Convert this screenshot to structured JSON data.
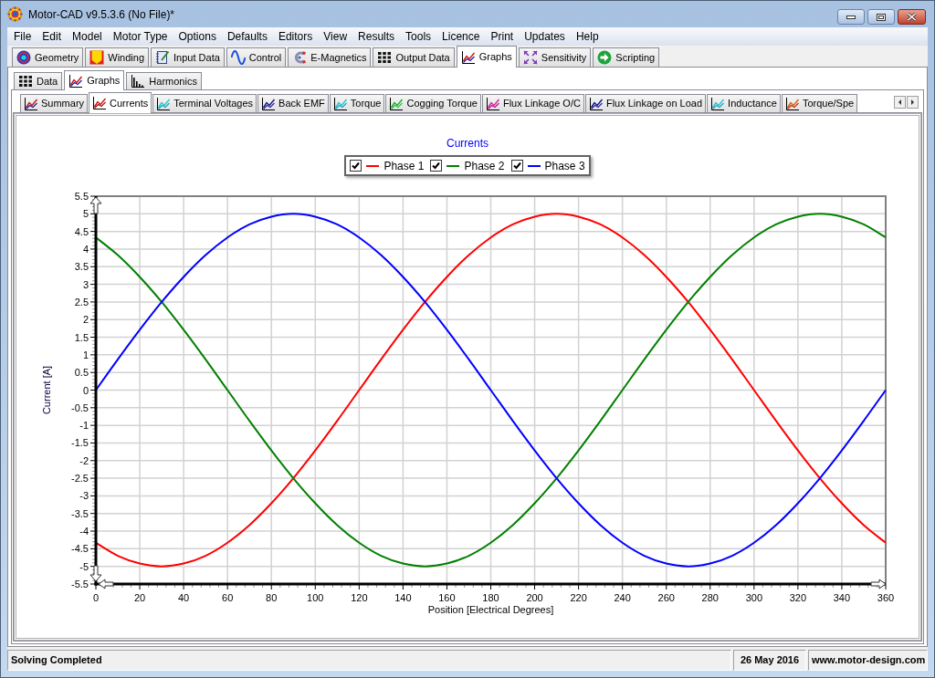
{
  "window": {
    "title": "Motor-CAD v9.5.3.6 (No File)*"
  },
  "menu": [
    "File",
    "Edit",
    "Model",
    "Motor Type",
    "Options",
    "Defaults",
    "Editors",
    "View",
    "Results",
    "Tools",
    "Licence",
    "Print",
    "Updates",
    "Help"
  ],
  "main_tabs": [
    {
      "label": "Geometry",
      "selected": false
    },
    {
      "label": "Winding",
      "selected": false
    },
    {
      "label": "Input Data",
      "selected": false
    },
    {
      "label": "Control",
      "selected": false
    },
    {
      "label": "E-Magnetics",
      "selected": false
    },
    {
      "label": "Output Data",
      "selected": false
    },
    {
      "label": "Graphs",
      "selected": true
    },
    {
      "label": "Sensitivity",
      "selected": false
    },
    {
      "label": "Scripting",
      "selected": false
    }
  ],
  "sub_tabs": [
    {
      "label": "Data",
      "selected": false
    },
    {
      "label": "Graphs",
      "selected": true
    },
    {
      "label": "Harmonics",
      "selected": false
    }
  ],
  "graph_tabs": [
    {
      "label": "Summary",
      "selected": false
    },
    {
      "label": "Currents",
      "selected": true
    },
    {
      "label": "Terminal Voltages",
      "selected": false
    },
    {
      "label": "Back EMF",
      "selected": false
    },
    {
      "label": "Torque",
      "selected": false
    },
    {
      "label": "Cogging Torque",
      "selected": false
    },
    {
      "label": "Flux Linkage O/C",
      "selected": false
    },
    {
      "label": "Flux Linkage on Load",
      "selected": false
    },
    {
      "label": "Inductance",
      "selected": false
    },
    {
      "label": "Torque/Spe",
      "selected": false
    }
  ],
  "graph": {
    "legend": [
      {
        "checked": true
      },
      {
        "checked": true
      },
      {
        "checked": true
      }
    ],
    "chart_data": {
      "type": "line",
      "title": "Currents",
      "xlabel": "Position [Electrical Degrees]",
      "ylabel": "Current [A]",
      "x": [
        0,
        10,
        20,
        30,
        40,
        50,
        60,
        70,
        80,
        90,
        100,
        110,
        120,
        130,
        140,
        150,
        160,
        170,
        180,
        190,
        200,
        210,
        220,
        230,
        240,
        250,
        260,
        270,
        280,
        290,
        300,
        310,
        320,
        330,
        340,
        350,
        360
      ],
      "series": [
        {
          "name": "Phase 1",
          "color": "#ff0000",
          "values": [
            -4.33,
            -4.7,
            -4.92,
            -5,
            -4.92,
            -4.7,
            -4.33,
            -3.83,
            -3.21,
            -2.5,
            -1.71,
            -0.87,
            0,
            0.87,
            1.71,
            2.5,
            3.21,
            3.83,
            4.33,
            4.7,
            4.92,
            5,
            4.92,
            4.7,
            4.33,
            3.83,
            3.21,
            2.5,
            1.71,
            0.87,
            0,
            -0.87,
            -1.71,
            -2.5,
            -3.21,
            -3.83,
            -4.33
          ]
        },
        {
          "name": "Phase 2",
          "color": "#008000",
          "values": [
            4.33,
            3.83,
            3.21,
            2.5,
            1.71,
            0.87,
            0,
            -0.87,
            -1.71,
            -2.5,
            -3.21,
            -3.83,
            -4.33,
            -4.7,
            -4.92,
            -5,
            -4.92,
            -4.7,
            -4.33,
            -3.83,
            -3.21,
            -2.5,
            -1.71,
            -0.87,
            0,
            0.87,
            1.71,
            2.5,
            3.21,
            3.83,
            4.33,
            4.7,
            4.92,
            5,
            4.92,
            4.7,
            4.33
          ]
        },
        {
          "name": "Phase 3",
          "color": "#0000ff",
          "values": [
            0,
            0.87,
            1.71,
            2.5,
            3.21,
            3.83,
            4.33,
            4.7,
            4.92,
            5,
            4.92,
            4.7,
            4.33,
            3.83,
            3.21,
            2.5,
            1.71,
            0.87,
            0,
            -0.87,
            -1.71,
            -2.5,
            -3.21,
            -3.83,
            -4.33,
            -4.7,
            -4.92,
            -5,
            -4.92,
            -4.7,
            -4.33,
            -3.83,
            -3.21,
            -2.5,
            -1.71,
            -0.87,
            0
          ]
        }
      ],
      "xlim": [
        0,
        360
      ],
      "ylim": [
        -5.5,
        5.5
      ],
      "xticks": [
        0,
        20,
        40,
        60,
        80,
        100,
        120,
        140,
        160,
        180,
        200,
        220,
        240,
        260,
        280,
        300,
        320,
        340,
        360
      ],
      "yticks": [
        -5.5,
        -5,
        -4.5,
        -4,
        -3.5,
        -3,
        -2.5,
        -2,
        -1.5,
        -1,
        -0.5,
        0,
        0.5,
        1,
        1.5,
        2,
        2.5,
        3,
        3.5,
        4,
        4.5,
        5,
        5.5
      ],
      "grid": true
    }
  },
  "status_bar": {
    "message": "Solving Completed",
    "date": "26 May 2016",
    "website": "www.motor-design.com"
  }
}
